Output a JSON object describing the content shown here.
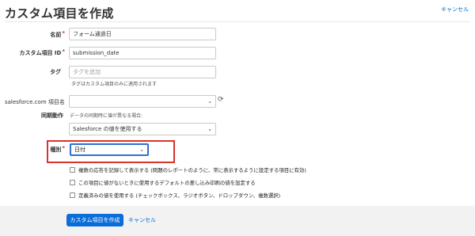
{
  "header": {
    "title": "カスタム項目を作成",
    "cancel_label": "キャンセル"
  },
  "form": {
    "name": {
      "label": "名前",
      "value": "フォーム通過日"
    },
    "custom_id": {
      "label": "カスタム項目 ID",
      "value": "submission_date"
    },
    "tag": {
      "label": "タグ",
      "placeholder": "タグを追加",
      "help": "タグはカスタム項目のみに適用されます"
    },
    "salesforce_field": {
      "label": "salesforce.com 項目名",
      "value": ""
    },
    "sync": {
      "label": "同期動作",
      "help": "データの同期時に値が異なる場合:",
      "value": "Salesforce の値を使用する"
    },
    "type": {
      "label": "種別",
      "value": "日付"
    },
    "checkboxes": [
      "複数の応答を記録して表示する (問題のレポートのように、常に表示するように設定する項目に有効)",
      "この項目に値がないときに使用するデフォルトの差し込み印刷の値を設定する",
      "定義済みの値を使用する (チェックボックス、ラジオボタン、ドロップダウン、複数選択)"
    ]
  },
  "footer": {
    "create_label": "カスタム項目を作成",
    "cancel_label": "キャンセル"
  },
  "colors": {
    "primary": "#0b6dd8",
    "highlight": "#d9342b",
    "link": "#0070d2"
  }
}
